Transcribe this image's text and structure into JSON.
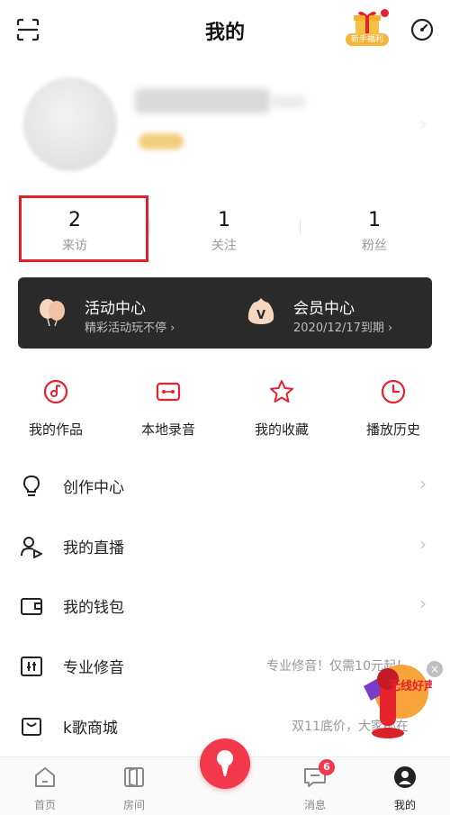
{
  "header": {
    "title": "我的",
    "gift_label": "新手福利"
  },
  "stats": [
    {
      "value": "2",
      "label": "来访"
    },
    {
      "value": "1",
      "label": "关注"
    },
    {
      "value": "1",
      "label": "粉丝"
    }
  ],
  "banner": {
    "activity": {
      "title": "活动中心",
      "subtitle": "精彩活动玩不停 ›"
    },
    "vip": {
      "title": "会员中心",
      "subtitle": "2020/12/17到期 ›"
    }
  },
  "quick": [
    {
      "label": "我的作品",
      "icon": "music-disc-icon"
    },
    {
      "label": "本地录音",
      "icon": "cassette-icon"
    },
    {
      "label": "我的收藏",
      "icon": "star-icon"
    },
    {
      "label": "播放历史",
      "icon": "clock-icon"
    }
  ],
  "menu": [
    {
      "label": "创作中心",
      "sub": "",
      "icon": "lightbulb-icon"
    },
    {
      "label": "我的直播",
      "sub": "",
      "icon": "live-user-icon"
    },
    {
      "label": "我的钱包",
      "sub": "",
      "icon": "wallet-icon"
    },
    {
      "label": "专业修音",
      "sub": "专业修音！仅需10元起！",
      "icon": "mixer-icon"
    },
    {
      "label": "k歌商城",
      "sub": "双11底价，大家都在",
      "icon": "shopping-bag-icon"
    }
  ],
  "promo": {
    "text": "无线好声"
  },
  "tabs": [
    {
      "label": "首页",
      "icon": "home-icon"
    },
    {
      "label": "房间",
      "icon": "room-door-icon"
    },
    {
      "label": "消息",
      "icon": "message-icon",
      "badge": "6"
    },
    {
      "label": "我的",
      "icon": "profile-icon"
    }
  ],
  "colors": {
    "accent": "#f2384a",
    "highlight": "#e0202a",
    "banner": "#2a2a2a"
  }
}
